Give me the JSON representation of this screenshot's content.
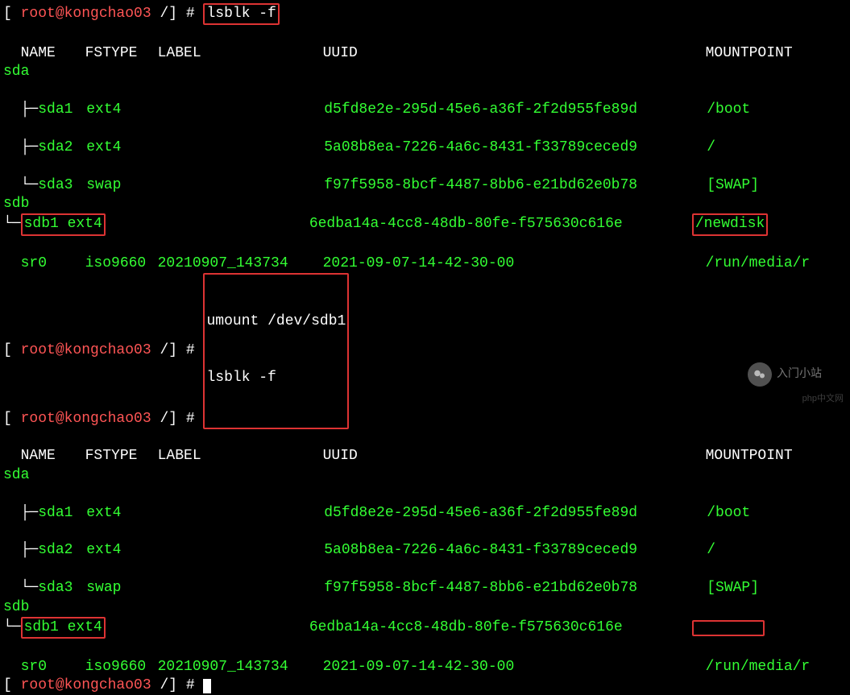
{
  "prompt1": {
    "open": "[",
    "userhost": " root@kongchao03 ",
    "path": "/",
    "close": "] # ",
    "cmd": "lsblk -f"
  },
  "header": {
    "name": "NAME",
    "fstype": "FSTYPE",
    "label": "LABEL",
    "uuid": "UUID",
    "mount": "MOUNTPOINT"
  },
  "block1": {
    "sda": "sda",
    "sda1": {
      "tree": "├─",
      "name": "sda1",
      "fstype": "ext4",
      "uuid": "d5fd8e2e-295d-45e6-a36f-2f2d955fe89d",
      "mount": "/boot"
    },
    "sda2": {
      "tree": "├─",
      "name": "sda2",
      "fstype": "ext4",
      "uuid": "5a08b8ea-7226-4a6c-8431-f33789ceced9",
      "mount": "/"
    },
    "sda3": {
      "tree": "└─",
      "name": "sda3",
      "fstype": "swap",
      "uuid": "f97f5958-8bcf-4487-8bb6-e21bd62e0b78",
      "mount": "[SWAP]"
    },
    "sdb": "sdb",
    "sdb1": {
      "tree": "└─",
      "name": "sdb1",
      "fstype": "ext4",
      "uuid": "6edba14a-4cc8-48db-80fe-f575630c616e",
      "mount": "/newdisk"
    },
    "sr0": {
      "name": "sr0",
      "fstype": "iso9660",
      "label": "20210907_143734",
      "uuid": "2021-09-07-14-42-30-00",
      "mount": "/run/media/r"
    }
  },
  "prompt2": {
    "open": "[",
    "userhost": " root@kongchao03 ",
    "path": "/",
    "close": "] # ",
    "cmd": "umount /dev/sdb1"
  },
  "prompt3": {
    "open": "[",
    "userhost": " root@kongchao03 ",
    "path": "/",
    "close": "] # ",
    "cmd": "lsblk -f"
  },
  "block2": {
    "sda": "sda",
    "sda1": {
      "tree": "├─",
      "name": "sda1",
      "fstype": "ext4",
      "uuid": "d5fd8e2e-295d-45e6-a36f-2f2d955fe89d",
      "mount": "/boot"
    },
    "sda2": {
      "tree": "├─",
      "name": "sda2",
      "fstype": "ext4",
      "uuid": "5a08b8ea-7226-4a6c-8431-f33789ceced9",
      "mount": "/"
    },
    "sda3": {
      "tree": "└─",
      "name": "sda3",
      "fstype": "swap",
      "uuid": "f97f5958-8bcf-4487-8bb6-e21bd62e0b78",
      "mount": "[SWAP]"
    },
    "sdb": "sdb",
    "sdb1": {
      "tree": "└─",
      "name": "sdb1",
      "fstype": "ext4",
      "uuid": "6edba14a-4cc8-48db-80fe-f575630c616e",
      "mount": ""
    },
    "sr0": {
      "name": "sr0",
      "fstype": "iso9660",
      "label": "20210907_143734",
      "uuid": "2021-09-07-14-42-30-00",
      "mount": "/run/media/r"
    }
  },
  "prompt4": {
    "open": "[",
    "userhost": " root@kongchao03 ",
    "path": "/",
    "close": "] # "
  },
  "watermark": "入门小站",
  "phpwm": "php中文网"
}
